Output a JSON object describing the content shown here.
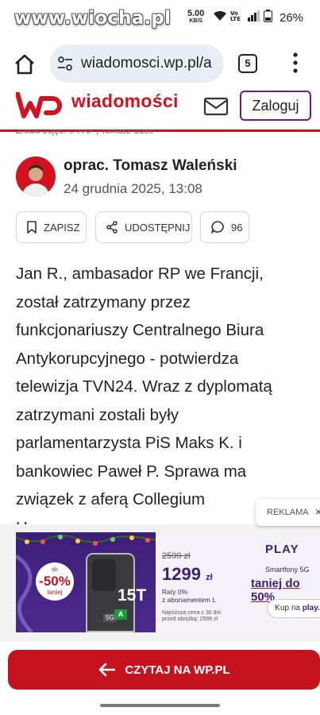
{
  "status_bar": {
    "watermark": "www.wiocha.pl",
    "net_speed": "5.00",
    "net_unit": "KB/S",
    "battery": "26%",
    "icons": [
      "wifi-icon",
      "volte-icon",
      "signal-icon",
      "battery-icon"
    ]
  },
  "browser": {
    "url": "wiadomosci.wp.pl/a",
    "tab_count": "5"
  },
  "site": {
    "logo_text": "wiadomości",
    "login_label": "Zaloguj",
    "source_line": "Źródło zdjęć: © PAP | Tomasz Gzell",
    "brand_color": "#d4121f"
  },
  "author": {
    "name": "oprac. Tomasz Waleński",
    "date": "24 grudnia 2025, 13:08"
  },
  "actions": {
    "save_label": "ZAPISZ",
    "share_label": "UDOSTĘPNIJ",
    "comments_count": "96"
  },
  "article": {
    "lines": [
      "Jan R., ambasador RP we Francji,",
      "został zatrzymany przez",
      "funkcjonariuszy Centralnego Biura",
      "Antykorupcyjnego - potwierdza",
      "telewizja TVN24. Wraz z dyplomatą",
      "zatrzymani zostali były",
      "parlamentarzysta PiS Maks K. i",
      "bankowiec Paweł P. Sprawa ma",
      "związek z aferą Collegium",
      "Humanum."
    ]
  },
  "ad": {
    "reklama_label": "REKLAMA",
    "close_symbol": "×",
    "discount_prefix": "do",
    "discount_value": "-50%",
    "discount_suffix": "taniej",
    "phone_model": "15T",
    "phone_5g": "5G",
    "energy_class": "A",
    "price_old": "2599 zł",
    "price_new": "1299",
    "price_unit": "zł",
    "installments": [
      "Raty 0%",
      "z abonamentem L"
    ],
    "lowest_price": [
      "Najniższa cena z 30 dni",
      "przed obniżką: 2599 zł"
    ],
    "brand": "PLAY",
    "smartphones_label": "Smartfony 5G",
    "offer": "taniej do 50%",
    "buy_prefix": "Kup na ",
    "buy_site": "play.pl",
    "brand_color": "#3e1e79"
  },
  "cta": {
    "label": "CZYTAJ NA WP.PL"
  }
}
